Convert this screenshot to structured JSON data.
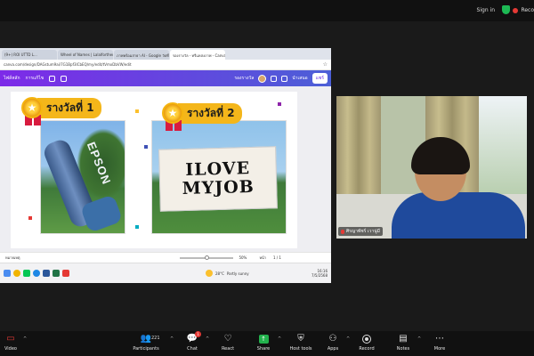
{
  "topbar": {
    "signin": "Sign in",
    "record_label": "Reco"
  },
  "browser": {
    "tabs": [
      "(9+) ROI UTTD L...",
      "Wheel of Names | Lalalfortheu...",
      "ภาพพร้อมสาธา AI - Google วัดที่",
      "รองรางวัล - ทรีแหล่งภาพ - Canva"
    ],
    "url": "canva.com/design/DAGstum9ai/7G1Bpf3ICbEQ/my/edit/tVmxDbVW/edit",
    "star": "☆"
  },
  "canva": {
    "menu_file": "ไฟล์หลัก",
    "menu_edit": "การแก้ไข",
    "doc_title": "รองรางวัล",
    "present_label": "นำเสนอ",
    "share_label": "แชร์"
  },
  "slide": {
    "award1": "รางวัลที่ 1",
    "award2": "รางวัลที่ 2",
    "bottle_text": "EPSON",
    "sign_line1": "ILOVE",
    "sign_line2": "MYJOB"
  },
  "canva_bottom": {
    "notes": "หมายเหตุ",
    "zoom": "50%",
    "pages_label": "หน้า",
    "page": "1 / 1"
  },
  "taskbar": {
    "weather_label": "28°C",
    "weather_sub": "Partly sunny",
    "time": "16:16",
    "date": "7/5/2568"
  },
  "participant": {
    "name": "ศิรญาพัชร์ เวานู่มี"
  },
  "toolbar": {
    "video": "Video",
    "participants": "Participants",
    "participants_count": "221",
    "chat": "Chat",
    "chat_badge": "1",
    "react": "React",
    "share": "Share",
    "host_tools": "Host tools",
    "apps": "Apps",
    "record": "Record",
    "notes": "Notes",
    "more": "More"
  },
  "colors": {
    "canva_purple": "#7d2ae8",
    "zoom_green": "#23b14d",
    "alert_red": "#e53935",
    "award_gold": "#f4b61a"
  }
}
